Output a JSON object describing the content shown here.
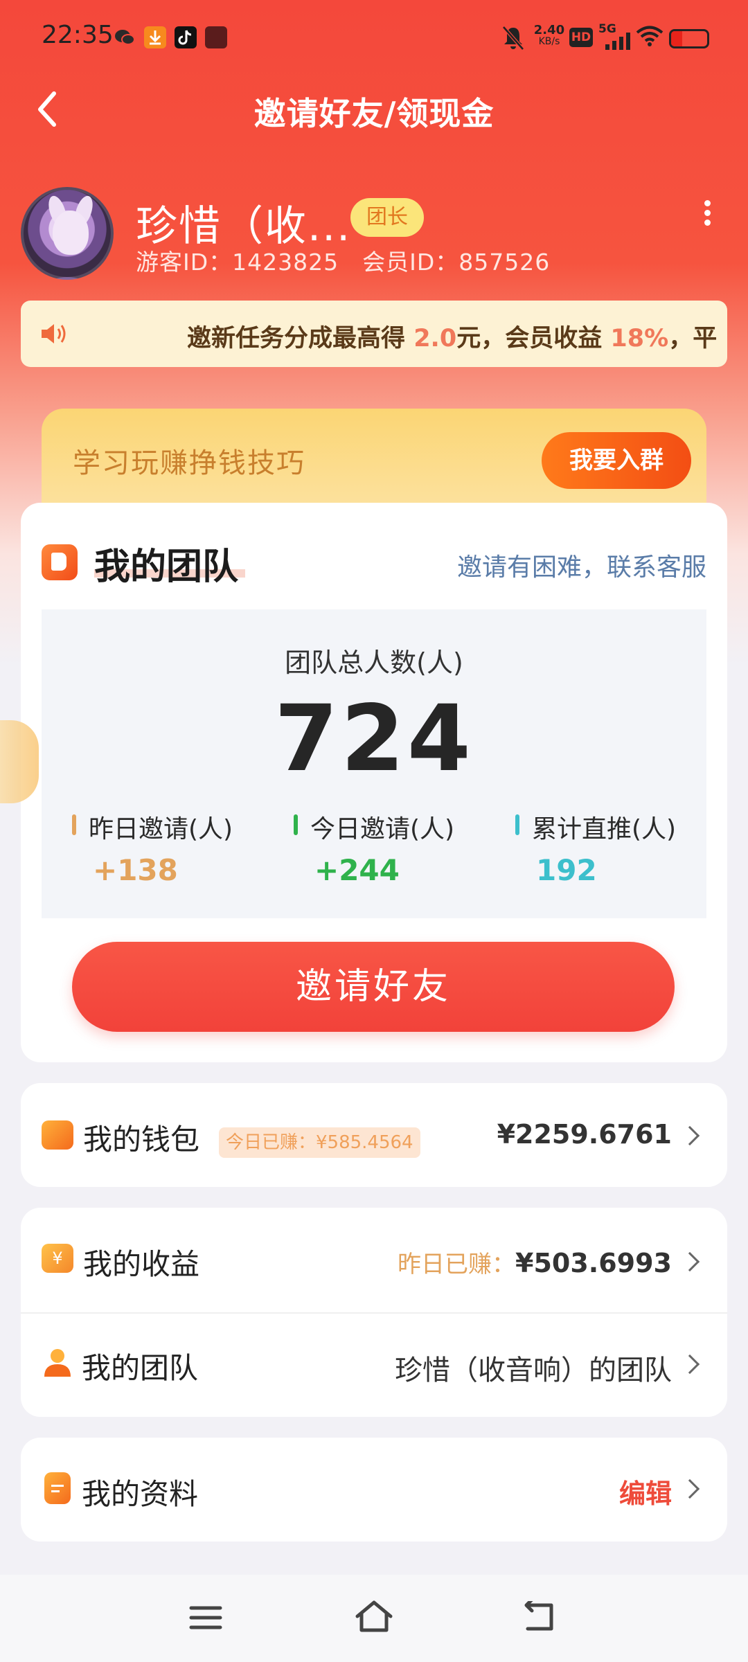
{
  "status_bar": {
    "time": "22:35",
    "net_speed_value": "2.40",
    "net_speed_unit": "KB/s",
    "hd_label": "HD",
    "network": "5G",
    "icons_left": [
      "wechat-icon",
      "download-icon",
      "tiktok-icon",
      "app-icon"
    ],
    "icons_right": [
      "mute-icon",
      "signal-icon",
      "wifi-icon",
      "battery-icon"
    ]
  },
  "nav": {
    "title": "邀请好友/领现金",
    "back_icon": "back-arrow-icon"
  },
  "profile": {
    "name": "珍惜（收...",
    "role": "团长",
    "visitor_id": "游客ID：1423825",
    "member_id": "会员ID：857526",
    "more_icon": "more-vertical-icon"
  },
  "notice": {
    "icon": "speaker-icon",
    "text_a": "邀新任务分成最高得",
    "value_a": "2.0",
    "text_b": "元，会员收益",
    "value_b": "18%",
    "text_c": "，平"
  },
  "learn_banner": {
    "text": "学习玩赚挣钱技巧",
    "button": "我要入群"
  },
  "team": {
    "title": "我的团队",
    "contact_link": "邀请有困难，联系客服",
    "total_label": "团队总人数(人)",
    "total_value": "724",
    "stats": [
      {
        "label": "昨日邀请(人)",
        "value": "+138",
        "color": "#e3a35c"
      },
      {
        "label": "今日邀请(人)",
        "value": "+244",
        "color": "#2fb24c"
      },
      {
        "label": "累计直推(人)",
        "value": "192",
        "color": "#3cbfcc"
      }
    ],
    "invite_button": "邀请好友"
  },
  "wallet": {
    "label": "我的钱包",
    "today_badge": "今日已赚：¥585.4564",
    "amount": "¥2259.6761"
  },
  "earnings": {
    "label": "我的收益",
    "prefix": "昨日已赚：",
    "amount": "¥503.6993"
  },
  "my_team": {
    "label": "我的团队",
    "value": "珍惜（收音响）的团队"
  },
  "profile_row": {
    "label": "我的资料",
    "action": "编辑"
  },
  "bottom_nav": {
    "icons": [
      "menu-icon",
      "home-icon",
      "back-icon"
    ]
  },
  "colors": {
    "primary_red": "#f4483b",
    "accent_orange": "#f34e14",
    "gold": "#fbd574"
  }
}
